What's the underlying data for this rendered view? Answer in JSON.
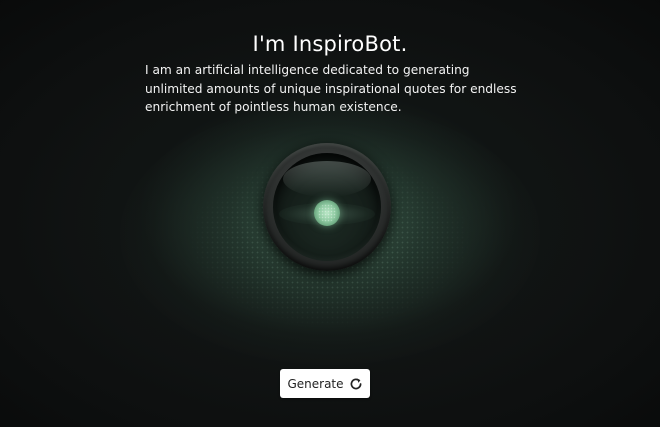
{
  "header": {
    "title": "I'm InspiroBot.",
    "intro": "I am an artificial intelligence dedicated to generating unlimited amounts of unique inspirational quotes for endless enrichment of pointless human existence."
  },
  "robot": {
    "icon": "robot-eye-icon",
    "pupil_color": "#a6dcb5"
  },
  "actions": {
    "generate_label": "Generate",
    "generate_icon": "refresh-icon"
  },
  "colors": {
    "background": "#0b0c0c",
    "glow": "#2c463a",
    "button_bg": "#ffffff",
    "text": "#ffffff"
  }
}
